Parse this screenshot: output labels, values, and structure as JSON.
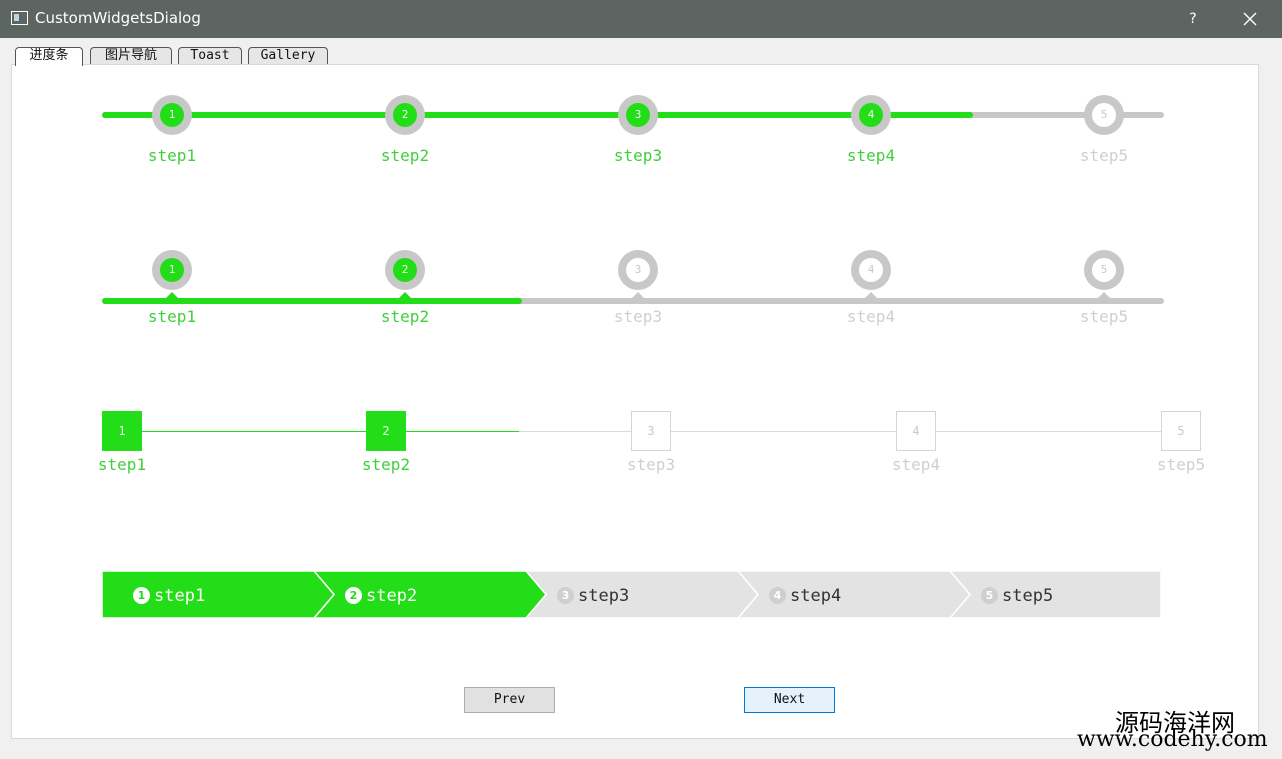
{
  "window": {
    "title": "CustomWidgetsDialog",
    "help_label": "?"
  },
  "tabs": [
    {
      "label": "进度条"
    },
    {
      "label": "图片导航"
    },
    {
      "label": "Toast"
    },
    {
      "label": "Gallery"
    }
  ],
  "progress": {
    "steps": [
      {
        "number": "1",
        "label": "step1"
      },
      {
        "number": "2",
        "label": "step2"
      },
      {
        "number": "3",
        "label": "step3"
      },
      {
        "number": "4",
        "label": "step4"
      },
      {
        "number": "5",
        "label": "step5"
      }
    ],
    "row1_fill": 0.82,
    "row1_current": 4,
    "row2_current": 2,
    "row3_current": 2,
    "row4_current": 2
  },
  "colors": {
    "active": "#22dd18",
    "inactive": "#c8c8c8",
    "label_active": "#3fcf3a"
  },
  "buttons": {
    "prev": "Prev",
    "next": "Next"
  },
  "watermark": {
    "line1": "源码海洋网",
    "line2": "www.codehy.com"
  }
}
